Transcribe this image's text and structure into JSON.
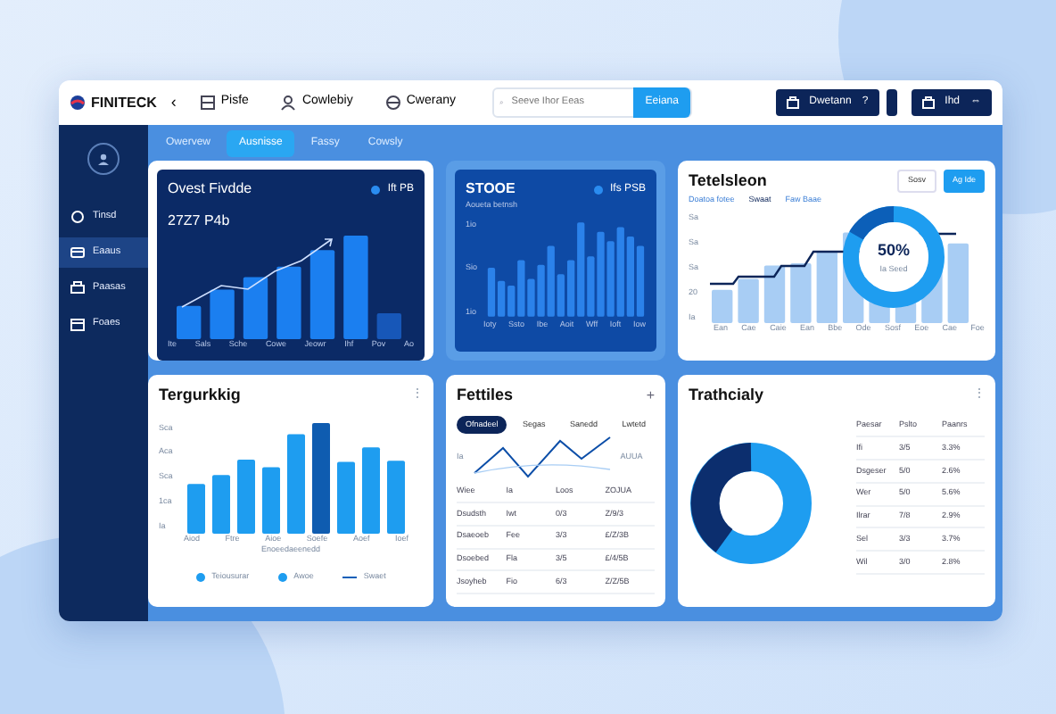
{
  "header": {
    "brand": "FINITECK",
    "back": "‹",
    "nav": [
      {
        "label": "Pisfe",
        "kind": "grid"
      },
      {
        "label": "Cowlebiy",
        "kind": "person"
      },
      {
        "label": "Cwerany",
        "kind": "globe"
      }
    ],
    "search": {
      "placeholder": "Seeve Ihor Eeas",
      "button": "Eeiana"
    },
    "actions": [
      {
        "label": "Dwetann",
        "trail": "?"
      },
      {
        "label": "Ihd",
        "trail": "⇔"
      }
    ]
  },
  "tabs": [
    {
      "label": "Owervew",
      "selected": false
    },
    {
      "label": "Ausnisse",
      "selected": true
    },
    {
      "label": "Fassy",
      "selected": false
    },
    {
      "label": "Cowsly",
      "selected": false
    }
  ],
  "sidebar": {
    "items": [
      {
        "label": "Tinsd",
        "selected": false,
        "kind": "circle"
      },
      {
        "label": "Eaaus",
        "selected": true,
        "kind": "card"
      },
      {
        "label": "Paasas",
        "selected": false,
        "kind": "printer"
      },
      {
        "label": "Foaes",
        "selected": false,
        "kind": "calendar"
      }
    ]
  },
  "growth_card": {
    "title": "Ovest Fivdde",
    "legend": "Ift PB",
    "value": "27Z7 P4b",
    "x_labels": [
      "Ite",
      "Sals",
      "Sche",
      "Cowe",
      "Jeowr",
      "Ihf",
      "Pov",
      "Ao"
    ]
  },
  "stock_card": {
    "title": "STOOE",
    "subtitle": "Aoueta betnsh",
    "legend": "Ifs PSB",
    "y_labels": [
      "1io",
      "Sio",
      "1io"
    ],
    "x_labels": [
      "Ioty",
      "Ssto",
      "Ibe",
      "Aoit",
      "Wff",
      "Ioft",
      "Iow"
    ]
  },
  "totals_card": {
    "title": "Tetelsleon",
    "buttons": [
      "Sosv",
      "Ag Ide"
    ],
    "filters": [
      "Doatoa fotee",
      "Swaat",
      "Faw Baae"
    ],
    "y_labels": [
      "Sa",
      "Sa",
      "Sa",
      "20",
      "Ia"
    ],
    "x_labels": [
      "Ean",
      "Cae",
      "Caie",
      "Ean",
      "Bbe",
      "Ode",
      "Sosf",
      "Eoe",
      "Cae",
      "Foe"
    ],
    "donut_value": "50%",
    "donut_caption": "Ia Seed"
  },
  "forecast_card": {
    "title": "Tergurkkig",
    "menu": "⋮",
    "y_labels": [
      "Sca",
      "Aca",
      "Sca",
      "1ca",
      "Ia"
    ],
    "x_labels": [
      "Aiod",
      "Ftre",
      "Aioe",
      "Soefe",
      "Aoef",
      "Ioef"
    ],
    "axis_title": "Enoeedaeenedd",
    "legend": [
      {
        "label": "Teiousurar",
        "kind": "dot"
      },
      {
        "label": "Awoe",
        "kind": "dot"
      },
      {
        "label": "Swaet",
        "kind": "line"
      }
    ]
  },
  "files_card": {
    "title": "Fettiles",
    "menu": "+",
    "pills": [
      {
        "label": "Ofnadeel",
        "selected": true
      },
      {
        "label": "Segas",
        "selected": false
      },
      {
        "label": "Sanedd",
        "selected": false
      },
      {
        "label": "Lwtetd",
        "selected": false
      }
    ],
    "chart_labels": [
      "Ia",
      "AUUA"
    ],
    "rows": [
      [
        "Wiee",
        "Ia",
        "Loos",
        "ZOJUA"
      ],
      [
        "Dsudsth",
        "Iwt",
        "0/3",
        "Z/9/3"
      ],
      [
        "Dsaeoeb",
        "Fee",
        "3/3",
        "£/Z/3B"
      ],
      [
        "Dsoebed",
        "Fla",
        "3/5",
        "£/4/5B"
      ],
      [
        "Jsoyheb",
        "Fio",
        "6/3",
        "Z/Z/5B"
      ]
    ]
  },
  "activity_card": {
    "title": "Trathcialy",
    "menu": "⋮",
    "columns": [
      "Paesar",
      "Pslto",
      "Paanrs"
    ],
    "rows": [
      [
        "Ifi",
        "3/5",
        "3.3%"
      ],
      [
        "Dsgeser",
        "5/0",
        "2.6%"
      ],
      [
        "Wer",
        "5/0",
        "5.6%"
      ],
      [
        "Ilrar",
        "7/8",
        "2.9%"
      ],
      [
        "Sel",
        "3/3",
        "3.7%"
      ],
      [
        "Wil",
        "3/0",
        "2.8%"
      ]
    ]
  }
}
